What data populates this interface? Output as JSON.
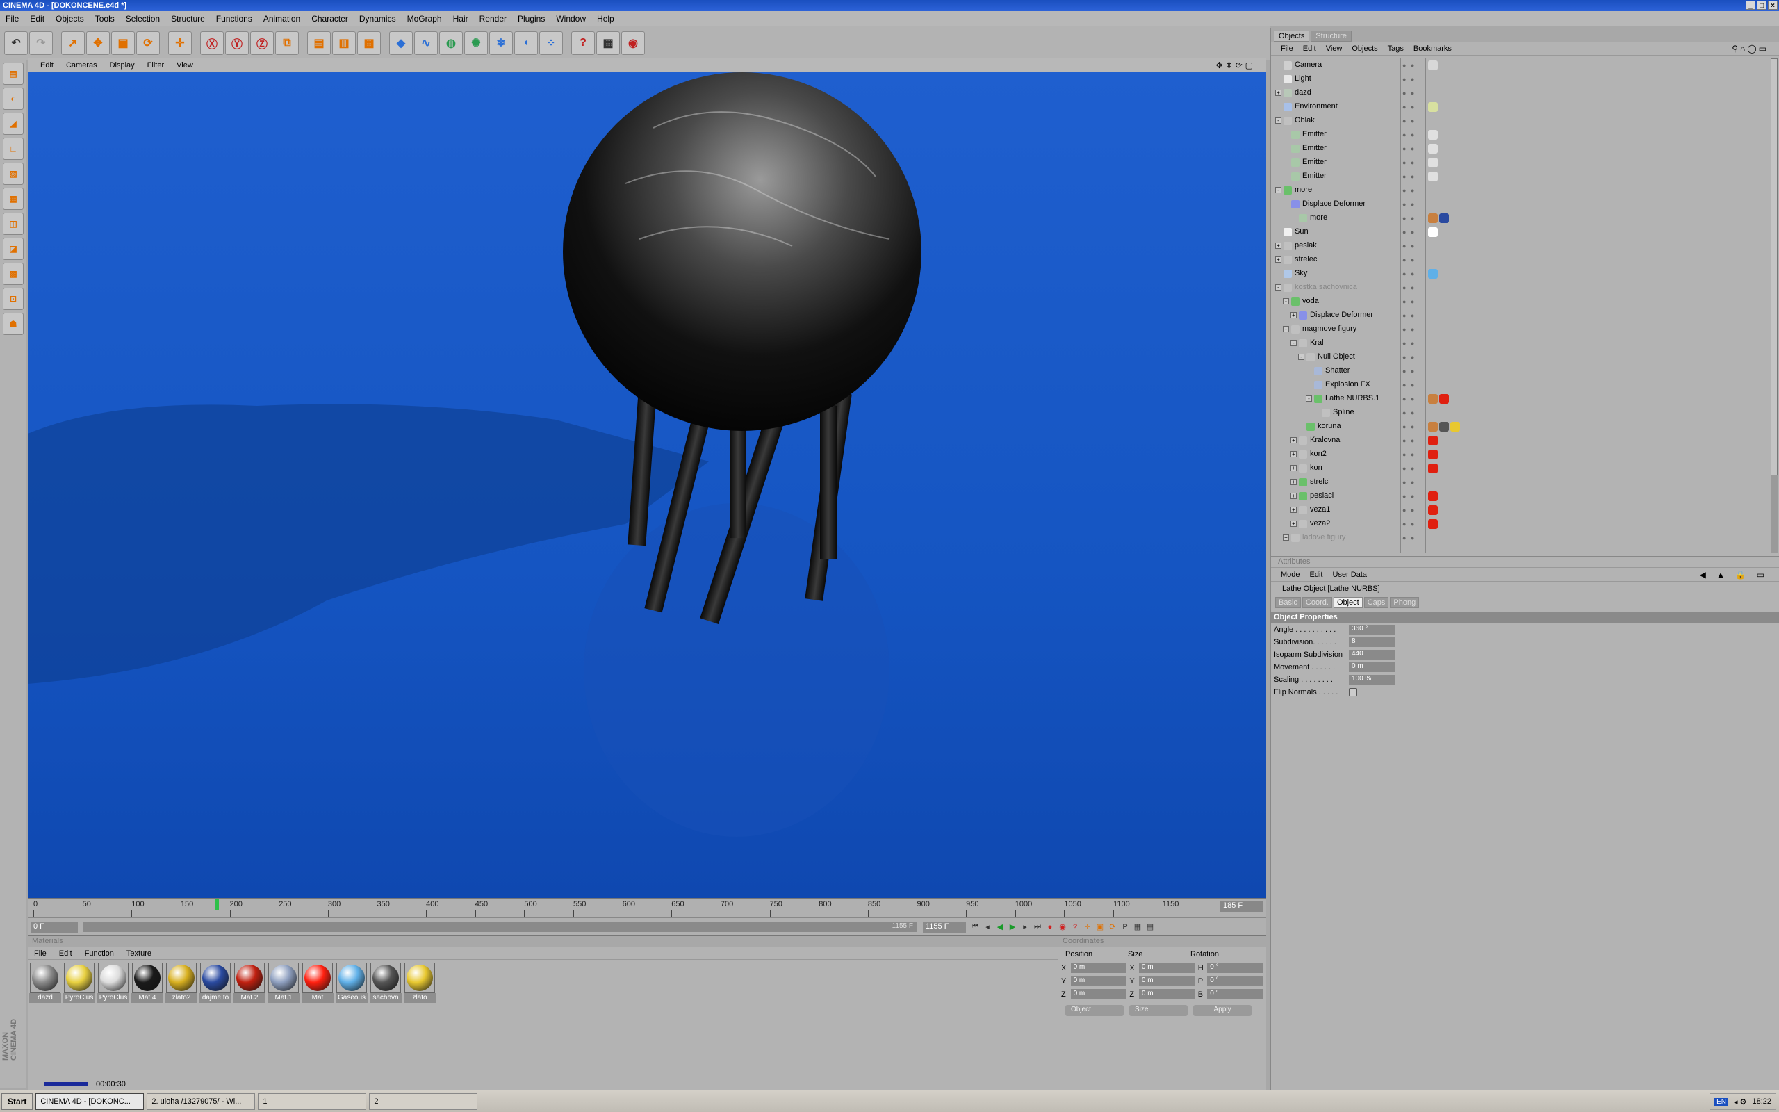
{
  "window": {
    "title": "CINEMA 4D - [DOKONCENE.c4d *]"
  },
  "menubar": [
    "File",
    "Edit",
    "Objects",
    "Tools",
    "Selection",
    "Structure",
    "Functions",
    "Animation",
    "Character",
    "Dynamics",
    "MoGraph",
    "Hair",
    "Render",
    "Plugins",
    "Window",
    "Help"
  ],
  "viewport_menu": [
    "Edit",
    "Cameras",
    "Display",
    "Filter",
    "View"
  ],
  "timeline": {
    "ticks": [
      "0",
      "50",
      "100",
      "150",
      "200",
      "250",
      "300",
      "350",
      "400",
      "450",
      "500",
      "550",
      "600",
      "650",
      "700",
      "750",
      "800",
      "850",
      "900",
      "950",
      "1000",
      "1050",
      "1100",
      "1150"
    ],
    "playhead_label": "185 0",
    "current_frame": "185 F"
  },
  "transport": {
    "start_frame": "0 F",
    "end_frame_a": "1155 F",
    "end_frame_b": "1155 F"
  },
  "materials": {
    "header": "Materials",
    "menu": [
      "File",
      "Edit",
      "Function",
      "Texture"
    ],
    "items": [
      {
        "label": "dazd",
        "color": "#8a8a8a"
      },
      {
        "label": "PyroClus",
        "color": "#e8d040"
      },
      {
        "label": "PyroClus",
        "color": "#dcdcdc"
      },
      {
        "label": "Mat.4",
        "color": "#1a1a1a"
      },
      {
        "label": "zlato2",
        "color": "#d8b020"
      },
      {
        "label": "dajme to",
        "color": "#2a4aa0"
      },
      {
        "label": "Mat.2",
        "color": "#c02010"
      },
      {
        "label": "Mat.1",
        "color": "#8fa0c0"
      },
      {
        "label": "Mat",
        "color": "#ff2010"
      },
      {
        "label": "Gaseous",
        "color": "#60b0e8"
      },
      {
        "label": "sachovn",
        "color": "#555555"
      },
      {
        "label": "zlato",
        "color": "#e8c830"
      }
    ]
  },
  "coordinates": {
    "header": "Coordinates",
    "columns": [
      "Position",
      "Size",
      "Rotation"
    ],
    "rows": [
      {
        "axis": "X",
        "pos": "0 m",
        "size_axis": "X",
        "size": "0 m",
        "rot_axis": "H",
        "rot": "0 °"
      },
      {
        "axis": "Y",
        "pos": "0 m",
        "size_axis": "Y",
        "size": "0 m",
        "rot_axis": "P",
        "rot": "0 °"
      },
      {
        "axis": "Z",
        "pos": "0 m",
        "size_axis": "Z",
        "size": "0 m",
        "rot_axis": "B",
        "rot": "0 °"
      }
    ],
    "mode_dropdown": "Object",
    "size_dropdown": "Size",
    "apply_label": "Apply"
  },
  "status": {
    "time": "00:00:30"
  },
  "objects_panel": {
    "tabs": [
      "Objects",
      "Structure"
    ],
    "menu": [
      "File",
      "Edit",
      "View",
      "Objects",
      "Tags",
      "Bookmarks"
    ],
    "items": [
      {
        "name": "Camera",
        "indent": 0,
        "exp": "",
        "icon": "#cfcfcf",
        "tags": [
          "#d8d8d8"
        ]
      },
      {
        "name": "Light",
        "indent": 0,
        "exp": "",
        "icon": "#e8e8e8",
        "tags": []
      },
      {
        "name": "dazd",
        "indent": 0,
        "exp": "+",
        "icon": "#b8c8b8",
        "tags": []
      },
      {
        "name": "Environment",
        "indent": 0,
        "exp": "",
        "icon": "#a8c0e8",
        "tags": [
          "#d8e0a0"
        ]
      },
      {
        "name": "Oblak",
        "indent": 0,
        "exp": "-",
        "icon": "#c0c0c0",
        "tags": []
      },
      {
        "name": "Emitter",
        "indent": 1,
        "exp": "",
        "icon": "#a8c8a8",
        "tags": [
          "#e0e0e0"
        ]
      },
      {
        "name": "Emitter",
        "indent": 1,
        "exp": "",
        "icon": "#a8c8a8",
        "tags": [
          "#e0e0e0"
        ]
      },
      {
        "name": "Emitter",
        "indent": 1,
        "exp": "",
        "icon": "#a8c8a8",
        "tags": [
          "#e0e0e0"
        ]
      },
      {
        "name": "Emitter",
        "indent": 1,
        "exp": "",
        "icon": "#a8c8a8",
        "tags": [
          "#e0e0e0"
        ]
      },
      {
        "name": "more",
        "indent": 0,
        "exp": "-",
        "icon": "#6ac06a",
        "tags": []
      },
      {
        "name": "Displace Deformer",
        "indent": 1,
        "exp": "",
        "icon": "#8890e8",
        "tags": []
      },
      {
        "name": "more",
        "indent": 2,
        "exp": "",
        "icon": "#a8c8a8",
        "tags": [
          "#c88040",
          "#2a4aa0"
        ]
      },
      {
        "name": "Sun",
        "indent": 0,
        "exp": "",
        "icon": "#f0f0f0",
        "tags": [
          "#ffffff"
        ]
      },
      {
        "name": "pesiak",
        "indent": 0,
        "exp": "+",
        "icon": "#c0c0c0",
        "tags": []
      },
      {
        "name": "strelec",
        "indent": 0,
        "exp": "+",
        "icon": "#c0c0c0",
        "tags": []
      },
      {
        "name": "Sky",
        "indent": 0,
        "exp": "",
        "icon": "#b0c8e8",
        "tags": [
          "#60b0e8"
        ]
      },
      {
        "name": "kostka sachovnica",
        "indent": 0,
        "exp": "-",
        "icon": "#c0c0c0",
        "tags": [],
        "dim": true
      },
      {
        "name": "voda",
        "indent": 1,
        "exp": "-",
        "icon": "#6ac06a",
        "tags": []
      },
      {
        "name": "Displace Deformer",
        "indent": 2,
        "exp": "+",
        "icon": "#8890e8",
        "tags": []
      },
      {
        "name": "magmove figury",
        "indent": 1,
        "exp": "-",
        "icon": "#c0c0c0",
        "tags": []
      },
      {
        "name": "Kral",
        "indent": 2,
        "exp": "-",
        "icon": "#c0c0c0",
        "tags": []
      },
      {
        "name": "Null Object",
        "indent": 3,
        "exp": "-",
        "icon": "#c0c0c0",
        "tags": []
      },
      {
        "name": "Shatter",
        "indent": 4,
        "exp": "",
        "icon": "#a8b8d8",
        "tags": []
      },
      {
        "name": "Explosion FX",
        "indent": 4,
        "exp": "",
        "icon": "#a8b8d8",
        "tags": []
      },
      {
        "name": "Lathe NURBS.1",
        "indent": 4,
        "exp": "-",
        "icon": "#6ac06a",
        "tags": [
          "#c88040",
          "#e02010"
        ]
      },
      {
        "name": "Spline",
        "indent": 5,
        "exp": "",
        "icon": "#c0c0c0",
        "tags": []
      },
      {
        "name": "koruna",
        "indent": 3,
        "exp": "",
        "icon": "#6ac06a",
        "tags": [
          "#c88040",
          "#555555",
          "#e8c830"
        ]
      },
      {
        "name": "Kralovna",
        "indent": 2,
        "exp": "+",
        "icon": "#c0c0c0",
        "tags": [
          "#e02010"
        ]
      },
      {
        "name": "kon2",
        "indent": 2,
        "exp": "+",
        "icon": "#c0c0c0",
        "tags": [
          "#e02010"
        ]
      },
      {
        "name": "kon",
        "indent": 2,
        "exp": "+",
        "icon": "#c0c0c0",
        "tags": [
          "#e02010"
        ]
      },
      {
        "name": "strelci",
        "indent": 2,
        "exp": "+",
        "icon": "#6ac06a",
        "tags": []
      },
      {
        "name": "pesiaci",
        "indent": 2,
        "exp": "+",
        "icon": "#6ac06a",
        "tags": [
          "#e02010"
        ]
      },
      {
        "name": "veza1",
        "indent": 2,
        "exp": "+",
        "icon": "#c0c0c0",
        "tags": [
          "#e02010"
        ]
      },
      {
        "name": "veza2",
        "indent": 2,
        "exp": "+",
        "icon": "#c0c0c0",
        "tags": [
          "#e02010"
        ]
      },
      {
        "name": "ladove figury",
        "indent": 1,
        "exp": "+",
        "icon": "#c0c0c0",
        "tags": [],
        "dim": true
      }
    ]
  },
  "attributes": {
    "header": "Attributes",
    "menu": [
      "Mode",
      "Edit",
      "User Data"
    ],
    "object_title": "Lathe Object [Lathe NURBS]",
    "tabs": [
      "Basic",
      "Coord.",
      "Object",
      "Caps",
      "Phong"
    ],
    "active_tab": "Object",
    "section": "Object Properties",
    "props": [
      {
        "label": "Angle . . . . . . . . . .",
        "value": "360 °"
      },
      {
        "label": "Subdivision. . . . . .",
        "value": "8"
      },
      {
        "label": "Isoparm Subdivision",
        "value": "440"
      },
      {
        "label": "Movement . . . . . .",
        "value": "0 m"
      },
      {
        "label": "Scaling . . . . . . . .",
        "value": "100 %"
      }
    ],
    "flip_label": "Flip Normals . . . . ."
  },
  "taskbar": {
    "start": "Start",
    "tasks": [
      "CINEMA 4D - [DOKONC...",
      "2. uloha /13279075/ - Wi...",
      "1",
      "2"
    ],
    "tray_lang": "EN",
    "clock": "18:22"
  },
  "colors": {
    "viewport_blue": "#1a5ac8",
    "accent_orange": "#e07000"
  }
}
